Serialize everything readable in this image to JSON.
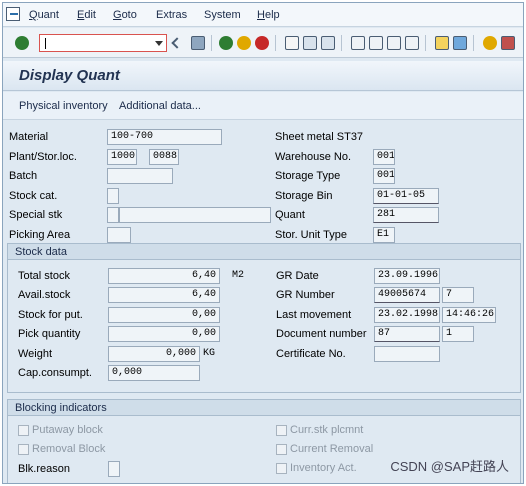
{
  "menu": {
    "items": [
      {
        "key": "Q",
        "rest": "uant"
      },
      {
        "key": "E",
        "rest": "dit"
      },
      {
        "key": "G",
        "rest": "oto"
      },
      {
        "key": "",
        "rest": "Extras"
      },
      {
        "key": "",
        "rest": "System"
      },
      {
        "key": "H",
        "rest": "elp"
      }
    ]
  },
  "toolbar": {
    "command_value": ""
  },
  "title": "Display Quant",
  "app_toolbar": {
    "physical_inventory": "Physical inventory",
    "additional_data": "Additional data..."
  },
  "header": {
    "material_label": "Material",
    "material": "100-700",
    "material_desc": "Sheet metal ST37",
    "plant_label": "Plant/Stor.loc.",
    "plant": "1000",
    "stor_loc": "0088",
    "warehouse_label": "Warehouse No.",
    "warehouse": "001",
    "batch_label": "Batch",
    "batch": "",
    "storage_type_label": "Storage Type",
    "storage_type": "001",
    "stock_cat_label": "Stock cat.",
    "stock_cat": "",
    "storage_bin_label": "Storage Bin",
    "storage_bin": "01-01-05",
    "special_stk_label": "Special stk",
    "special_stk": "",
    "special_stk_no": "",
    "quant_label": "Quant",
    "quant": "281",
    "picking_area_label": "Picking Area",
    "picking_area": "",
    "stor_unit_type_label": "Stor. Unit Type",
    "stor_unit_type": "E1"
  },
  "stock_data": {
    "header": "Stock data",
    "total_stock_label": "Total stock",
    "total_stock": "6,40",
    "uom": "M2",
    "avail_stock_label": "Avail.stock",
    "avail_stock": "6,40",
    "stock_put_label": "Stock for put.",
    "stock_put": "0,00",
    "pick_qty_label": "Pick quantity",
    "pick_qty": "0,00",
    "weight_label": "Weight",
    "weight": "0,000",
    "weight_unit": "KG",
    "cap_label": "Cap.consumpt.",
    "cap": "0,000",
    "gr_date_label": "GR Date",
    "gr_date": "23.09.1996",
    "gr_number_label": "GR Number",
    "gr_number": "49005674",
    "gr_item": "7",
    "last_movement_label": "Last movement",
    "last_movement_date": "23.02.1998",
    "last_movement_time": "14:46:26",
    "doc_number_label": "Document number",
    "doc_number": "87",
    "doc_item": "1",
    "cert_label": "Certificate No.",
    "cert": ""
  },
  "blocking": {
    "header": "Blocking indicators",
    "putaway_block": "Putaway block",
    "removal_block": "Removal Block",
    "blk_reason_label": "Blk.reason",
    "blk_reason": "",
    "curr_stk_plcmnt": "Curr.stk plcmnt",
    "current_removal": "Current Removal",
    "inventory_act": "Inventory Act."
  },
  "watermark": "CSDN @SAP赶路人",
  "colors": {
    "accent": "#2c6ea9",
    "background": "#dfe9f2",
    "title": "#223352"
  }
}
